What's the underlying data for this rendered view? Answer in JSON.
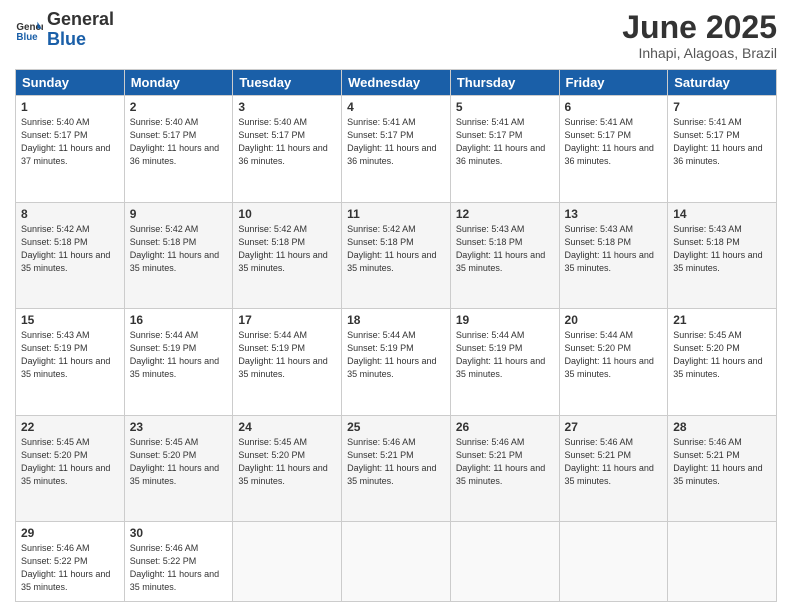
{
  "header": {
    "logo_line1": "General",
    "logo_line2": "Blue",
    "month": "June 2025",
    "location": "Inhapi, Alagoas, Brazil"
  },
  "days_of_week": [
    "Sunday",
    "Monday",
    "Tuesday",
    "Wednesday",
    "Thursday",
    "Friday",
    "Saturday"
  ],
  "weeks": [
    [
      {
        "day": "1",
        "sunrise": "5:40 AM",
        "sunset": "5:17 PM",
        "daylight": "11 hours and 37 minutes."
      },
      {
        "day": "2",
        "sunrise": "5:40 AM",
        "sunset": "5:17 PM",
        "daylight": "11 hours and 36 minutes."
      },
      {
        "day": "3",
        "sunrise": "5:40 AM",
        "sunset": "5:17 PM",
        "daylight": "11 hours and 36 minutes."
      },
      {
        "day": "4",
        "sunrise": "5:41 AM",
        "sunset": "5:17 PM",
        "daylight": "11 hours and 36 minutes."
      },
      {
        "day": "5",
        "sunrise": "5:41 AM",
        "sunset": "5:17 PM",
        "daylight": "11 hours and 36 minutes."
      },
      {
        "day": "6",
        "sunrise": "5:41 AM",
        "sunset": "5:17 PM",
        "daylight": "11 hours and 36 minutes."
      },
      {
        "day": "7",
        "sunrise": "5:41 AM",
        "sunset": "5:17 PM",
        "daylight": "11 hours and 36 minutes."
      }
    ],
    [
      {
        "day": "8",
        "sunrise": "5:42 AM",
        "sunset": "5:18 PM",
        "daylight": "11 hours and 35 minutes."
      },
      {
        "day": "9",
        "sunrise": "5:42 AM",
        "sunset": "5:18 PM",
        "daylight": "11 hours and 35 minutes."
      },
      {
        "day": "10",
        "sunrise": "5:42 AM",
        "sunset": "5:18 PM",
        "daylight": "11 hours and 35 minutes."
      },
      {
        "day": "11",
        "sunrise": "5:42 AM",
        "sunset": "5:18 PM",
        "daylight": "11 hours and 35 minutes."
      },
      {
        "day": "12",
        "sunrise": "5:43 AM",
        "sunset": "5:18 PM",
        "daylight": "11 hours and 35 minutes."
      },
      {
        "day": "13",
        "sunrise": "5:43 AM",
        "sunset": "5:18 PM",
        "daylight": "11 hours and 35 minutes."
      },
      {
        "day": "14",
        "sunrise": "5:43 AM",
        "sunset": "5:18 PM",
        "daylight": "11 hours and 35 minutes."
      }
    ],
    [
      {
        "day": "15",
        "sunrise": "5:43 AM",
        "sunset": "5:19 PM",
        "daylight": "11 hours and 35 minutes."
      },
      {
        "day": "16",
        "sunrise": "5:44 AM",
        "sunset": "5:19 PM",
        "daylight": "11 hours and 35 minutes."
      },
      {
        "day": "17",
        "sunrise": "5:44 AM",
        "sunset": "5:19 PM",
        "daylight": "11 hours and 35 minutes."
      },
      {
        "day": "18",
        "sunrise": "5:44 AM",
        "sunset": "5:19 PM",
        "daylight": "11 hours and 35 minutes."
      },
      {
        "day": "19",
        "sunrise": "5:44 AM",
        "sunset": "5:19 PM",
        "daylight": "11 hours and 35 minutes."
      },
      {
        "day": "20",
        "sunrise": "5:44 AM",
        "sunset": "5:20 PM",
        "daylight": "11 hours and 35 minutes."
      },
      {
        "day": "21",
        "sunrise": "5:45 AM",
        "sunset": "5:20 PM",
        "daylight": "11 hours and 35 minutes."
      }
    ],
    [
      {
        "day": "22",
        "sunrise": "5:45 AM",
        "sunset": "5:20 PM",
        "daylight": "11 hours and 35 minutes."
      },
      {
        "day": "23",
        "sunrise": "5:45 AM",
        "sunset": "5:20 PM",
        "daylight": "11 hours and 35 minutes."
      },
      {
        "day": "24",
        "sunrise": "5:45 AM",
        "sunset": "5:20 PM",
        "daylight": "11 hours and 35 minutes."
      },
      {
        "day": "25",
        "sunrise": "5:46 AM",
        "sunset": "5:21 PM",
        "daylight": "11 hours and 35 minutes."
      },
      {
        "day": "26",
        "sunrise": "5:46 AM",
        "sunset": "5:21 PM",
        "daylight": "11 hours and 35 minutes."
      },
      {
        "day": "27",
        "sunrise": "5:46 AM",
        "sunset": "5:21 PM",
        "daylight": "11 hours and 35 minutes."
      },
      {
        "day": "28",
        "sunrise": "5:46 AM",
        "sunset": "5:21 PM",
        "daylight": "11 hours and 35 minutes."
      }
    ],
    [
      {
        "day": "29",
        "sunrise": "5:46 AM",
        "sunset": "5:22 PM",
        "daylight": "11 hours and 35 minutes."
      },
      {
        "day": "30",
        "sunrise": "5:46 AM",
        "sunset": "5:22 PM",
        "daylight": "11 hours and 35 minutes."
      },
      null,
      null,
      null,
      null,
      null
    ]
  ]
}
